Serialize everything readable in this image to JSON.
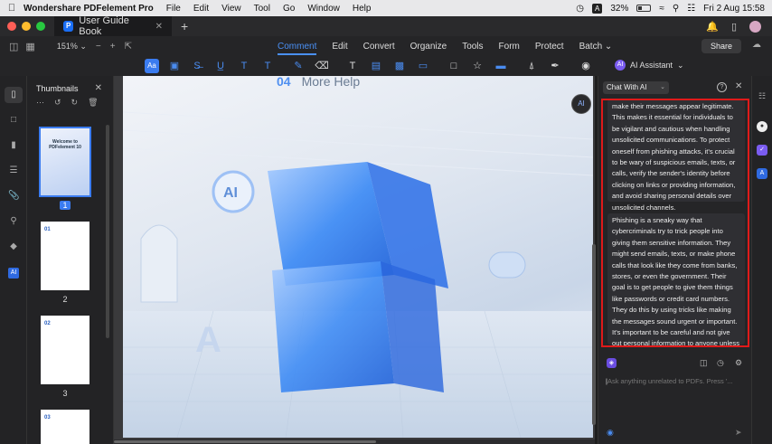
{
  "menubar": {
    "app_name": "Wondershare PDFelement Pro",
    "items": [
      "File",
      "Edit",
      "View",
      "Tool",
      "Go",
      "Window",
      "Help"
    ],
    "input_badge": "A",
    "battery": "32%",
    "battery_level": 0.32,
    "datetime": "Fri 2 Aug 15:58"
  },
  "tabbar": {
    "tab_title": "User Guide Book",
    "traffic_colors": [
      "#ff5f57",
      "#febc2e",
      "#28c840"
    ]
  },
  "toolbar": {
    "zoom": "151%",
    "menus": [
      "Comment",
      "Edit",
      "Convert",
      "Organize",
      "Tools",
      "Form",
      "Protect",
      "Batch"
    ],
    "active_menu": "Comment",
    "share_label": "Share"
  },
  "tools": {
    "ai_assistant_label": "AI Assistant"
  },
  "thumbnails": {
    "title": "Thumbnails",
    "pages": [
      {
        "num": "1",
        "heading": "Welcome to PDFelement 10"
      },
      {
        "num": "2",
        "heading": "01"
      },
      {
        "num": "3",
        "heading": "02"
      },
      {
        "num": "",
        "heading": "03"
      }
    ]
  },
  "document": {
    "section_number": "04",
    "section_title": "More Help"
  },
  "ai_panel": {
    "mode": "Chat With AI",
    "message_1": "make their messages appear legitimate. This makes it essential for individuals to be vigilant and cautious when handling unsolicited communications. To protect oneself from phishing attacks, it's crucial to be wary of suspicious emails, texts, or calls, verify the sender's identity before clicking on links or providing information, and avoid sharing personal details over unsolicited channels.",
    "message_2": "Phishing is a sneaky way that cybercriminals try to trick people into giving them sensitive information. They might send emails, texts, or make phone calls that look like they come from banks, stores, or even the government. Their goal is to get people to give them things like passwords or credit card numbers. They do this by using tricks like making the messages sound urgent or important. It's important to be careful and not give out personal information to anyone unless you're sure they're trustworthy.",
    "input_placeholder": "Ask anything unrelated to PDFs. Press '...",
    "highlight_color": "#e01a1a"
  }
}
